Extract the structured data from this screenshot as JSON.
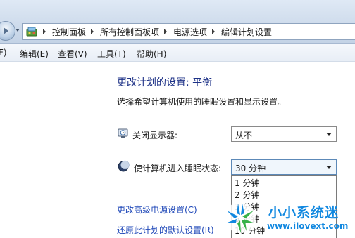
{
  "breadcrumb": {
    "items": [
      "控制面板",
      "所有控制面板项",
      "电源选项",
      "编辑计划设置"
    ]
  },
  "menu": {
    "items": [
      "F)",
      "编辑(E)",
      "查看(V)",
      "工具(T)",
      "帮助(H)"
    ]
  },
  "page": {
    "title": "更改计划的设置: 平衡",
    "subtitle": "选择希望计算机使用的睡眠设置和显示设置。"
  },
  "settings": {
    "display_off": {
      "label": "关闭显示器:",
      "value": "从不",
      "icon": "monitor-clock-icon"
    },
    "sleep": {
      "label": "使计算机进入睡眠状态:",
      "value": "30 分钟",
      "icon": "moon-icon",
      "options_visible": [
        "1 分钟",
        "2 分钟",
        "3 分钟",
        "5 分钟",
        "10 分钟"
      ]
    }
  },
  "links": {
    "advanced": "更改高级电源设置(C)",
    "restore": "还原此计划的默认设置(R)"
  },
  "watermark": {
    "name": "小小系统迷",
    "url": "www.ilovext.com"
  },
  "colors": {
    "title": "#1e3287",
    "link": "#1f48b8",
    "watermark": "#1188e0"
  }
}
